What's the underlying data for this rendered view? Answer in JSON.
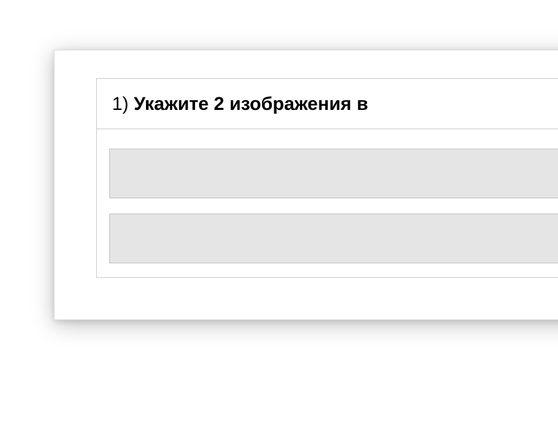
{
  "question": {
    "number": "1)",
    "prompt": "Укажите 2 изображения в"
  }
}
